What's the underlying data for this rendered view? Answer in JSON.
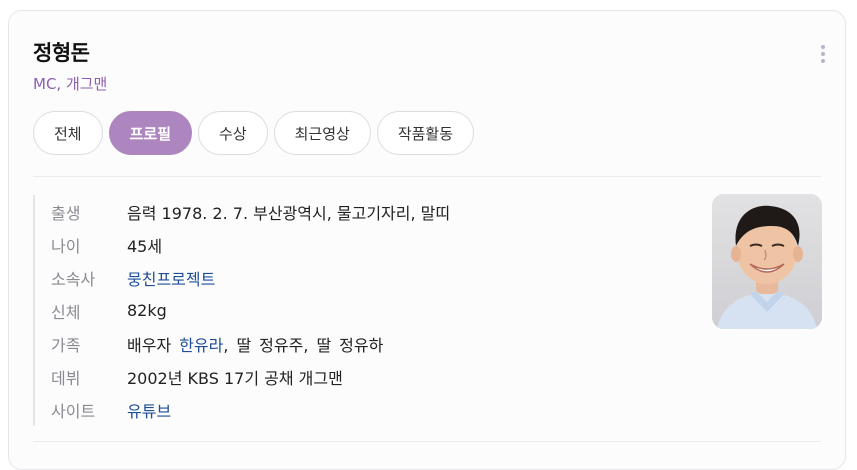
{
  "profile": {
    "name": "정형돈",
    "subtitle": "MC, 개그맨"
  },
  "tabs": [
    {
      "label": "전체",
      "active": false
    },
    {
      "label": "프로필",
      "active": true
    },
    {
      "label": "수상",
      "active": false
    },
    {
      "label": "최근영상",
      "active": false
    },
    {
      "label": "작품활동",
      "active": false
    }
  ],
  "info": {
    "birth": {
      "label": "출생",
      "value": "음력 1978. 2. 7. 부산광역시, 물고기자리, 말띠"
    },
    "age": {
      "label": "나이",
      "value": "45세"
    },
    "agency": {
      "label": "소속사",
      "value": "뭉친프로젝트"
    },
    "body": {
      "label": "신체",
      "value": "82kg"
    },
    "family": {
      "label": "가족",
      "spouse_relation": "배우자",
      "spouse_name": "한유라",
      "sep1": ",",
      "daughter1_relation": "딸",
      "daughter1_name": "정유주",
      "sep2": ",",
      "daughter2_relation": "딸",
      "daughter2_name": "정유하"
    },
    "debut": {
      "label": "데뷔",
      "value": "2002년 KBS 17기 공채 개그맨"
    },
    "site": {
      "label": "사이트",
      "value": "유튜브"
    }
  },
  "colors": {
    "accent": "#ad86c0",
    "subtitle": "#8c5fb0",
    "link": "#1f4e99"
  },
  "icons": {
    "more": "more-vertical-icon",
    "photo": "profile-photo"
  }
}
